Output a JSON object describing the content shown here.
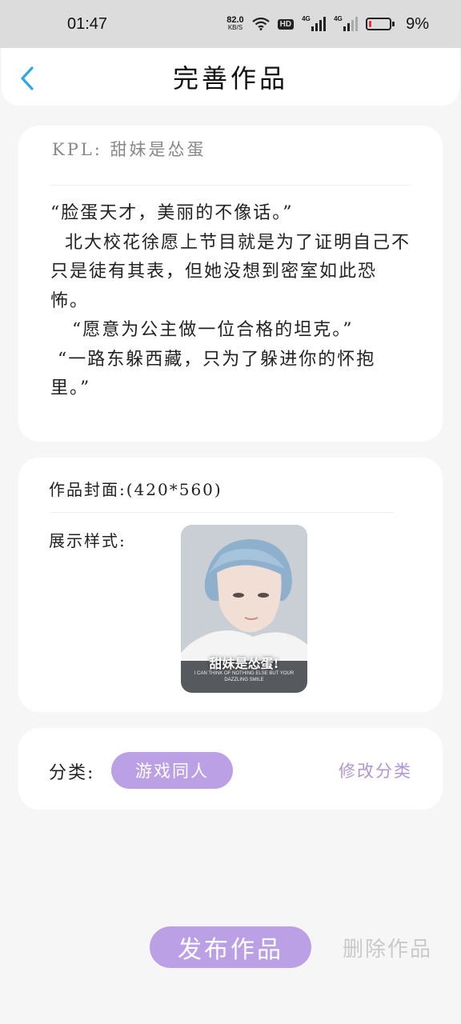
{
  "status_bar": {
    "time": "01:47",
    "net_speed_value": "82.0",
    "net_speed_unit": "KB/S",
    "hd_label": "HD",
    "signal1_label": "4G",
    "signal2_label": "4G",
    "battery_percent": "9%",
    "battery_color": "#e33333",
    "icons": [
      "wifi-icon",
      "hd-icon",
      "signal-icon",
      "signal-icon",
      "battery-icon"
    ]
  },
  "header": {
    "title": "完善作品",
    "back_icon": "chevron-left-icon",
    "accent_color": "#2ea6e8"
  },
  "preview": {
    "title": "KPL: 甜妹是怂蛋",
    "body": "“脸蛋天才，美丽的不像话。”\n  北大校花徐愿上节目就是为了证明自己不只是徒有其表，但她没想到密室如此恐怖。\n   “愿意为公主做一位合格的坦克。”\n “一路东躲西藏，只为了躲进你的怀抱里。”"
  },
  "cover": {
    "label": "作品封面:(420*560)",
    "style_label": "展示样式:",
    "image_title": "甜妹是怂蛋!",
    "image_subtitle": "I CAN THINK OF NOTHING ELSE BUT YOUR DAZZLING SMILE"
  },
  "category": {
    "label": "分类:",
    "value": "游戏同人",
    "edit_label": "修改分类",
    "chip_color": "#bba0e6"
  },
  "actions": {
    "publish_label": "发布作品",
    "delete_label": "删除作品"
  }
}
